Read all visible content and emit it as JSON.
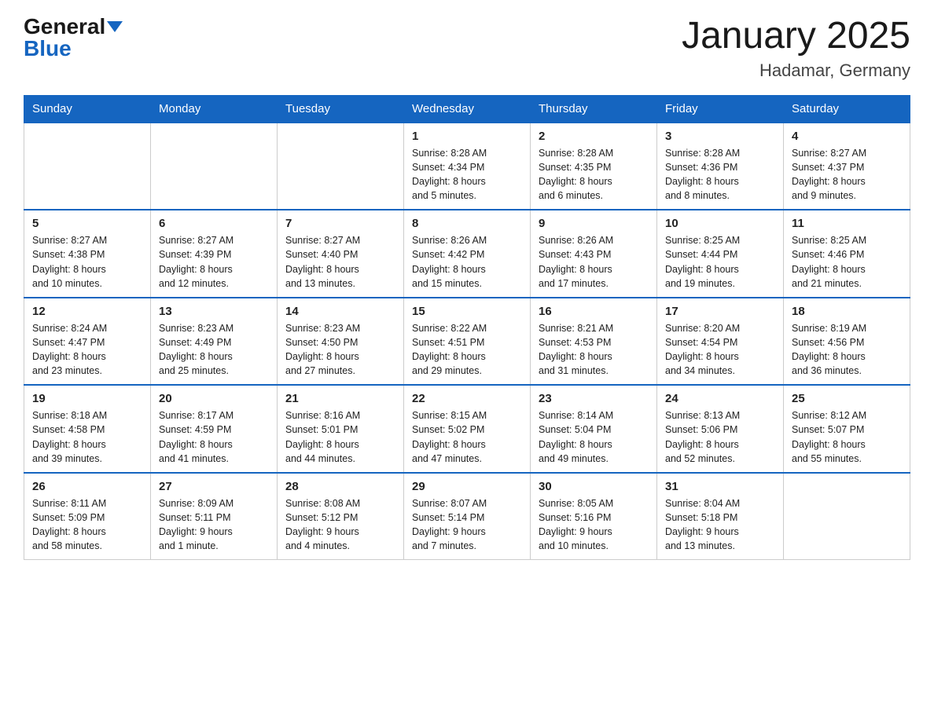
{
  "header": {
    "logo_general": "General",
    "logo_blue": "Blue",
    "month_title": "January 2025",
    "location": "Hadamar, Germany"
  },
  "days_of_week": [
    "Sunday",
    "Monday",
    "Tuesday",
    "Wednesday",
    "Thursday",
    "Friday",
    "Saturday"
  ],
  "weeks": [
    [
      {
        "day": "",
        "info": ""
      },
      {
        "day": "",
        "info": ""
      },
      {
        "day": "",
        "info": ""
      },
      {
        "day": "1",
        "info": "Sunrise: 8:28 AM\nSunset: 4:34 PM\nDaylight: 8 hours\nand 5 minutes."
      },
      {
        "day": "2",
        "info": "Sunrise: 8:28 AM\nSunset: 4:35 PM\nDaylight: 8 hours\nand 6 minutes."
      },
      {
        "day": "3",
        "info": "Sunrise: 8:28 AM\nSunset: 4:36 PM\nDaylight: 8 hours\nand 8 minutes."
      },
      {
        "day": "4",
        "info": "Sunrise: 8:27 AM\nSunset: 4:37 PM\nDaylight: 8 hours\nand 9 minutes."
      }
    ],
    [
      {
        "day": "5",
        "info": "Sunrise: 8:27 AM\nSunset: 4:38 PM\nDaylight: 8 hours\nand 10 minutes."
      },
      {
        "day": "6",
        "info": "Sunrise: 8:27 AM\nSunset: 4:39 PM\nDaylight: 8 hours\nand 12 minutes."
      },
      {
        "day": "7",
        "info": "Sunrise: 8:27 AM\nSunset: 4:40 PM\nDaylight: 8 hours\nand 13 minutes."
      },
      {
        "day": "8",
        "info": "Sunrise: 8:26 AM\nSunset: 4:42 PM\nDaylight: 8 hours\nand 15 minutes."
      },
      {
        "day": "9",
        "info": "Sunrise: 8:26 AM\nSunset: 4:43 PM\nDaylight: 8 hours\nand 17 minutes."
      },
      {
        "day": "10",
        "info": "Sunrise: 8:25 AM\nSunset: 4:44 PM\nDaylight: 8 hours\nand 19 minutes."
      },
      {
        "day": "11",
        "info": "Sunrise: 8:25 AM\nSunset: 4:46 PM\nDaylight: 8 hours\nand 21 minutes."
      }
    ],
    [
      {
        "day": "12",
        "info": "Sunrise: 8:24 AM\nSunset: 4:47 PM\nDaylight: 8 hours\nand 23 minutes."
      },
      {
        "day": "13",
        "info": "Sunrise: 8:23 AM\nSunset: 4:49 PM\nDaylight: 8 hours\nand 25 minutes."
      },
      {
        "day": "14",
        "info": "Sunrise: 8:23 AM\nSunset: 4:50 PM\nDaylight: 8 hours\nand 27 minutes."
      },
      {
        "day": "15",
        "info": "Sunrise: 8:22 AM\nSunset: 4:51 PM\nDaylight: 8 hours\nand 29 minutes."
      },
      {
        "day": "16",
        "info": "Sunrise: 8:21 AM\nSunset: 4:53 PM\nDaylight: 8 hours\nand 31 minutes."
      },
      {
        "day": "17",
        "info": "Sunrise: 8:20 AM\nSunset: 4:54 PM\nDaylight: 8 hours\nand 34 minutes."
      },
      {
        "day": "18",
        "info": "Sunrise: 8:19 AM\nSunset: 4:56 PM\nDaylight: 8 hours\nand 36 minutes."
      }
    ],
    [
      {
        "day": "19",
        "info": "Sunrise: 8:18 AM\nSunset: 4:58 PM\nDaylight: 8 hours\nand 39 minutes."
      },
      {
        "day": "20",
        "info": "Sunrise: 8:17 AM\nSunset: 4:59 PM\nDaylight: 8 hours\nand 41 minutes."
      },
      {
        "day": "21",
        "info": "Sunrise: 8:16 AM\nSunset: 5:01 PM\nDaylight: 8 hours\nand 44 minutes."
      },
      {
        "day": "22",
        "info": "Sunrise: 8:15 AM\nSunset: 5:02 PM\nDaylight: 8 hours\nand 47 minutes."
      },
      {
        "day": "23",
        "info": "Sunrise: 8:14 AM\nSunset: 5:04 PM\nDaylight: 8 hours\nand 49 minutes."
      },
      {
        "day": "24",
        "info": "Sunrise: 8:13 AM\nSunset: 5:06 PM\nDaylight: 8 hours\nand 52 minutes."
      },
      {
        "day": "25",
        "info": "Sunrise: 8:12 AM\nSunset: 5:07 PM\nDaylight: 8 hours\nand 55 minutes."
      }
    ],
    [
      {
        "day": "26",
        "info": "Sunrise: 8:11 AM\nSunset: 5:09 PM\nDaylight: 8 hours\nand 58 minutes."
      },
      {
        "day": "27",
        "info": "Sunrise: 8:09 AM\nSunset: 5:11 PM\nDaylight: 9 hours\nand 1 minute."
      },
      {
        "day": "28",
        "info": "Sunrise: 8:08 AM\nSunset: 5:12 PM\nDaylight: 9 hours\nand 4 minutes."
      },
      {
        "day": "29",
        "info": "Sunrise: 8:07 AM\nSunset: 5:14 PM\nDaylight: 9 hours\nand 7 minutes."
      },
      {
        "day": "30",
        "info": "Sunrise: 8:05 AM\nSunset: 5:16 PM\nDaylight: 9 hours\nand 10 minutes."
      },
      {
        "day": "31",
        "info": "Sunrise: 8:04 AM\nSunset: 5:18 PM\nDaylight: 9 hours\nand 13 minutes."
      },
      {
        "day": "",
        "info": ""
      }
    ]
  ]
}
